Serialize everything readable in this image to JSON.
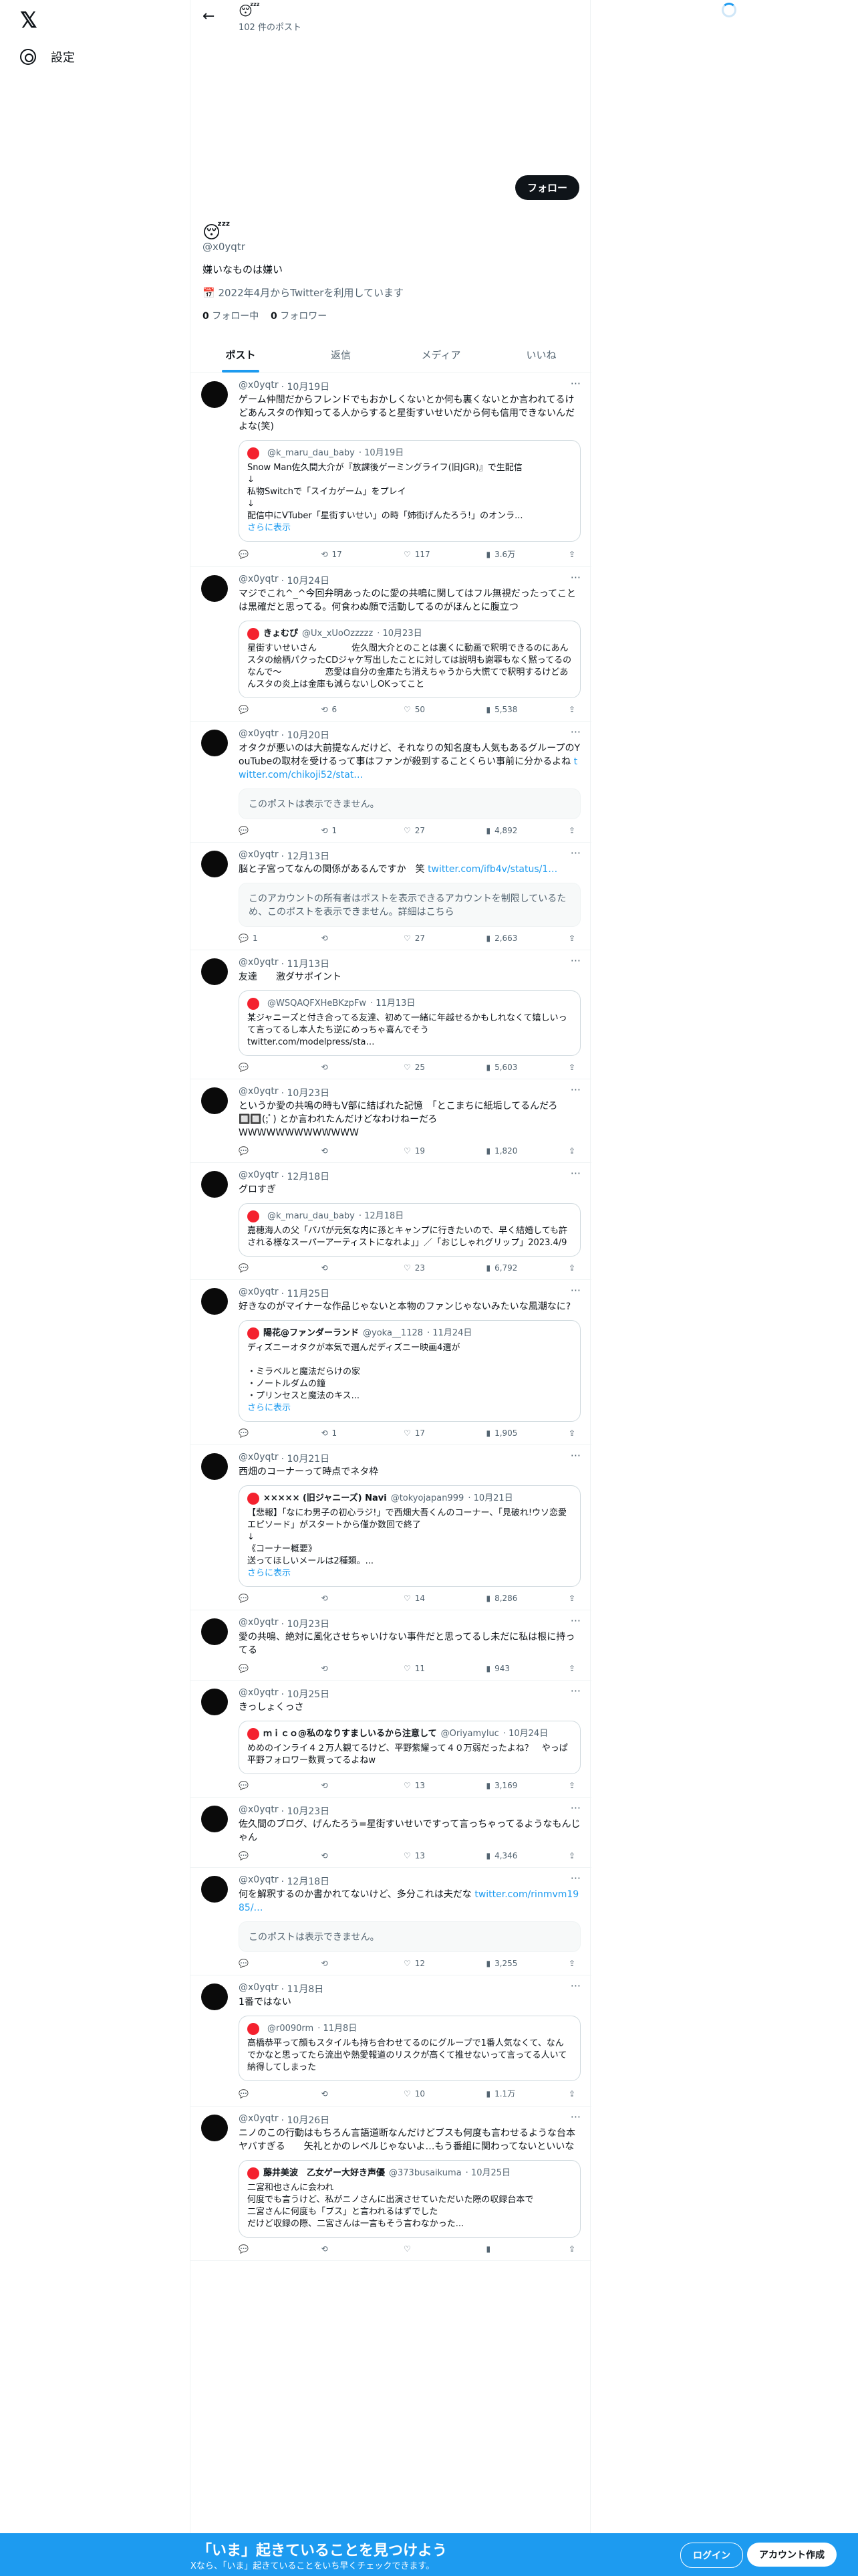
{
  "left": {
    "logo": "𝕏",
    "settings": "設定"
  },
  "header": {
    "back": "←",
    "name": "😴",
    "count": "102 件のポスト",
    "follow": "フォロー"
  },
  "profile": {
    "avatar": "😴",
    "handle": "@x0yqtr",
    "bio": "嫌いなものは嫌い",
    "joined": "📅 2022年4月からTwitterを利用しています",
    "following_num": "0",
    "following_label": " フォロー中",
    "followers_num": "0",
    "followers_label": " フォロワー"
  },
  "tabs": [
    "ポスト",
    "返信",
    "メディア",
    "いいね"
  ],
  "tweets": [
    {
      "handle": "@x0yqtr",
      "date": "· 10月19日",
      "text": "ゲーム仲間だからフレンドでもおかしくないとか何も裏くないとか言われてるけどあんスタの作知ってる人からすると星街すいせいだから何も信用できないんだよな(笑)",
      "quote": {
        "name": "",
        "handle": "@k_maru_dau_baby",
        "date": "· 10月19日",
        "text": "Snow Man佐久間大介が『放課後ゲーミングライフ(旧JGR)』で生配信\n↓\n私物Switchで「スイカゲーム」をプレイ\n↓\n配信中にVTuber「星街すいせい」の時「姉街げんたろう!」のオンラ...",
        "more": "さらに表示"
      },
      "reply": "",
      "rt": "17",
      "like": "117",
      "views": "3.6万"
    },
    {
      "handle": "@x0yqtr",
      "date": "· 10月24日",
      "text": "マジでこれ^_^今回弁明あったのに愛の共鳴に関してはフル無視だったってことは黒確だと思ってる。何食わぬ顔で活動してるのがほんとに腹立つ",
      "quote": {
        "name": "きょむぴ",
        "handle": "@Ux_xUoOzzzzz",
        "date": "· 10月23日",
        "text": "星街すいせいさん　　　　佐久間大介とのことは裏くに動画で釈明できるのにあんスタの絵柄パクったCDジャケ写出したことに対しては説明も謝罪もなく黙ってるのなんで〜　　　　　恋愛は自分の金庫たち消えちゃうから大慌てで釈明するけどあんスタの炎上は金庫も減らないしOKってこと",
        "more": ""
      },
      "reply": "",
      "rt": "6",
      "like": "50",
      "views": "5,538"
    },
    {
      "handle": "@x0yqtr",
      "date": "· 10月20日",
      "text": "オタクが悪いのは大前提なんだけど、それなりの知名度も人気もあるグループのYouTubeの取材を受けるって事はファンが殺到することくらい事前に分かるよね",
      "link": "twitter.com/chikoji52/stat…",
      "unavail": "このポストは表示できません。",
      "reply": "",
      "rt": "1",
      "like": "27",
      "views": "4,892"
    },
    {
      "handle": "@x0yqtr",
      "date": "· 12月13日",
      "text": "脳と子宮ってなんの関係があるんですか　笑",
      "link": "twitter.com/ifb4v/status/1…",
      "unavail": "このアカウントの所有者はポストを表示できるアカウントを制限しているため、このポストを表示できません。詳細はこちら",
      "reply": "1",
      "rt": "",
      "like": "27",
      "views": "2,663"
    },
    {
      "handle": "@x0yqtr",
      "date": "· 11月13日",
      "text": "友達　　激ダサポイント",
      "quote": {
        "name": "",
        "handle": "@WSQAQFXHeBKzpFw",
        "date": "· 11月13日",
        "text": "某ジャニーズと付き合ってる友達、初めて一緒に年越せるかもしれなくて嬉しいって言ってるし本人たち逆にめっちゃ喜んでそう\ntwitter.com/modelpress/sta…",
        "more": ""
      },
      "reply": "",
      "rt": "",
      "like": "25",
      "views": "5,603"
    },
    {
      "handle": "@x0yqtr",
      "date": "· 10月23日",
      "text": "というか愛の共鳴の時もV部に結ばれた記憶　「とこまちに紙垢してるんだろ　　🔲🔲(;ﾟ) とか言われたんだけどなわけねーだろ\nWWWWWWWWWWWWW",
      "reply": "",
      "rt": "",
      "like": "19",
      "views": "1,820"
    },
    {
      "handle": "@x0yqtr",
      "date": "· 12月18日",
      "text": "グロすぎ",
      "quote": {
        "name": "",
        "handle": "@k_maru_dau_baby",
        "date": "· 12月18日",
        "text": "嘉穂海人の父「パパが元気な内に孫とキャンプに行きたいので、早く結婚しても許される様なスーパーアーティストになれよ」」／「おじしゃれグリップ」2023.4/9",
        "more": ""
      },
      "reply": "",
      "rt": "",
      "like": "23",
      "views": "6,792"
    },
    {
      "handle": "@x0yqtr",
      "date": "· 11月25日",
      "text": "好きなのがマイナーな作品じゃないと本物のファンじゃないみたいな風潮なに?",
      "quote": {
        "name": "陽花@ファンダーランド",
        "handle": "@yoka__1128",
        "date": "· 11月24日",
        "text": "ディズニーオタクが本気で選んだディズニー映画4選が\n\n・ミラベルと魔法だらけの家\n・ノートルダムの鐘\n・プリンセスと魔法のキス...",
        "more": "さらに表示"
      },
      "reply": "",
      "rt": "1",
      "like": "17",
      "views": "1,905"
    },
    {
      "handle": "@x0yqtr",
      "date": "· 10月21日",
      "text": "西畑のコーナーって時点でネタ枠",
      "quote": {
        "name": "××××× (旧ジャニーズ) Navi",
        "handle": "@tokyojapan999",
        "date": "· 10月21日",
        "text": "【悲報】「なにわ男子の初心ラジ!」で西畑大吾くんのコーナー、「見破れ!ウソ恋愛エピソード」がスタートから僅か数回で終了\n↓\n《コーナー概要》\n送ってほしいメールは2種類。...",
        "more": "さらに表示"
      },
      "reply": "",
      "rt": "",
      "like": "14",
      "views": "8,286"
    },
    {
      "handle": "@x0yqtr",
      "date": "· 10月23日",
      "text": "愛の共鳴、絶対に風化させちゃいけない事件だと思ってるし未だに私は根に持ってる",
      "reply": "",
      "rt": "",
      "like": "11",
      "views": "943"
    },
    {
      "handle": "@x0yqtr",
      "date": "· 10月25日",
      "text": "きっしょくっさ",
      "quote": {
        "name": "ｍｉｃｏ@私のなりすましいるから注意して",
        "handle": "@Oriyamyluc",
        "date": "· 10月24日",
        "text": "めめのインライ４２万人観てるけど、平野紫耀って４０万弱だったよね？　やっぱ平野フォロワー数買ってるよねw",
        "more": ""
      },
      "reply": "",
      "rt": "",
      "like": "13",
      "views": "3,169"
    },
    {
      "handle": "@x0yqtr",
      "date": "· 10月23日",
      "text": "佐久間のブログ、げんたろう=星街すいせいですって言っちゃってるようなもんじゃん",
      "reply": "",
      "rt": "",
      "like": "13",
      "views": "4,346"
    },
    {
      "handle": "@x0yqtr",
      "date": "· 12月18日",
      "text": "何を解釈するのか書かれてないけど、多分これは夫だな",
      "link": "twitter.com/rinmvm1985/…",
      "unavail": "このポストは表示できません。",
      "reply": "",
      "rt": "",
      "like": "12",
      "views": "3,255"
    },
    {
      "handle": "@x0yqtr",
      "date": "· 11月8日",
      "text": "1番ではない",
      "quote": {
        "name": "",
        "handle": "@r0090rm",
        "date": "· 11月8日",
        "text": "高橋恭平って顔もスタイルも持ち合わせてるのにグループで1番人気なくて、なんでかなと思ってたら流出や熱愛報道のリスクが高くて推せないって言ってる人いて納得してしまった",
        "more": ""
      },
      "reply": "",
      "rt": "",
      "like": "10",
      "views": "1.1万"
    },
    {
      "handle": "@x0yqtr",
      "date": "· 10月26日",
      "text": "ニノのこの行動はもちろん言語道断なんだけどブスも何度も言わせるような台本ヤバすぎる　　矢礼とかのレベルじゃないよ…もう番組に関わってないといいな",
      "quote": {
        "name": "藤井美波　乙女ゲー大好き声優",
        "handle": "@373busaikuma",
        "date": "· 10月25日",
        "text": "二宮和也さんに会われ\n何度でも言うけど、私がニノさんに出演させていただいた際の収録台本で\n二宮さんに何度も「ブス」と言われるはずでした\nだけど収録の際、二宮さんは一言もそう言わなかった...",
        "more": ""
      },
      "reply": "",
      "rt": "",
      "like": "",
      "views": ""
    }
  ],
  "bottom": {
    "title": "「いま」起きていることを見つけよう",
    "sub": "Xなら、「いま」起きていることをいち早くチェックできます。",
    "login": "ログイン",
    "signup": "アカウント作成"
  }
}
